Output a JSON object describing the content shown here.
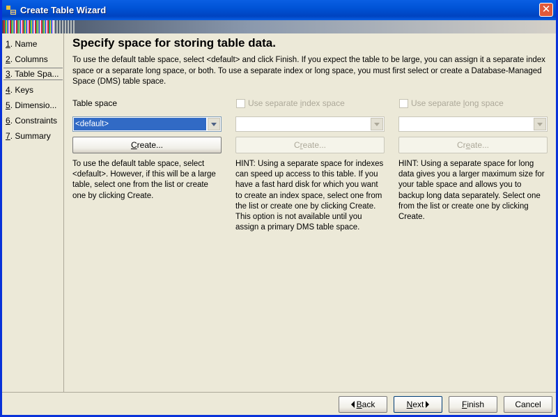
{
  "window": {
    "title": "Create Table Wizard",
    "close_glyph": "✕"
  },
  "steps": [
    {
      "num": "1",
      "label": ". Name"
    },
    {
      "num": "2",
      "label": ". Columns"
    },
    {
      "num": "3",
      "label": ". Table Spa..."
    },
    {
      "num": "4",
      "label": ". Keys"
    },
    {
      "num": "5",
      "label": ". Dimensio..."
    },
    {
      "num": "6",
      "label": ". Constraints"
    },
    {
      "num": "7",
      "label": ". Summary"
    }
  ],
  "page": {
    "heading": "Specify space for storing table data.",
    "intro": "To use the default table space, select <default> and click Finish. If you expect the table to be large, you can assign it a separate index space or a separate long space, or both. To use a separate index or long space, you must first select or create a Database-Managed Space (DMS) table space."
  },
  "table_space": {
    "label": "Table space",
    "value": "<default>",
    "create": {
      "pre": "",
      "key": "C",
      "post": "reate..."
    },
    "hint": "To use the default table space, select <default>. However, if this will be a large table, select one from the list or create one by clicking Create."
  },
  "index_space": {
    "checkbox": {
      "pre": "Use separate ",
      "key": "i",
      "post": "ndex space"
    },
    "value": "",
    "create": {
      "pre": "C",
      "key": "r",
      "post": "eate..."
    },
    "hint": "HINT: Using a separate space for indexes can speed up access to this table. If you have a fast hard disk for which you want to create an index space, select one from the list or create one by clicking Create. This option is not available until you assign a primary DMS table space."
  },
  "long_space": {
    "checkbox": {
      "pre": "Use separate ",
      "key": "l",
      "post": "ong space"
    },
    "value": "",
    "create": {
      "pre": "Cr",
      "key": "e",
      "post": "ate..."
    },
    "hint": "HINT: Using a separate space for long data gives you a larger maximum size for your table space and allows you to backup long data separately. Select one from the list or create one by clicking Create."
  },
  "footer": {
    "back": {
      "key": "B",
      "post": "ack"
    },
    "next": {
      "key": "N",
      "post": "ext"
    },
    "finish": {
      "key": "F",
      "post": "inish"
    },
    "cancel": "Cancel"
  },
  "colors": {
    "title_bar": "#0053d6",
    "selection": "#316ac5",
    "window_bg": "#ece9d8",
    "disabled_text": "#aca899"
  }
}
